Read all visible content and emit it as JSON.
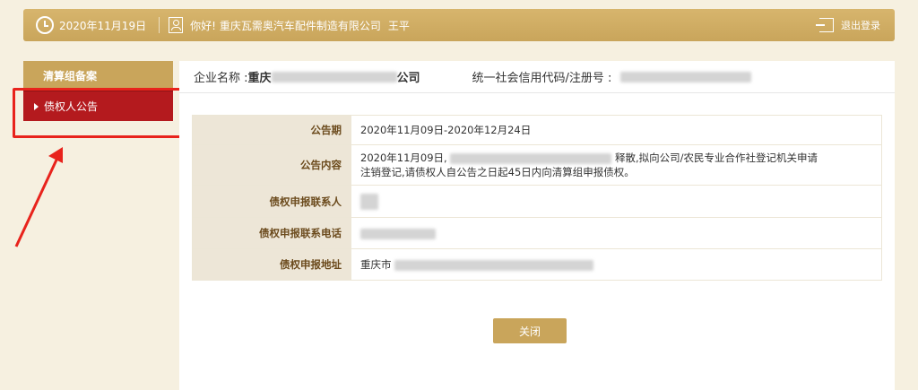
{
  "header": {
    "date": "2020年11月19日",
    "greeting": "你好!",
    "company": "重庆瓦需奥汽车配件制造有限公司",
    "username": "王平",
    "logout_label": "退出登录"
  },
  "sidebar": {
    "group_title": "清算组备案",
    "items": [
      {
        "label": "债权人公告",
        "active": true
      }
    ]
  },
  "main": {
    "company_name_label": "企业名称 :",
    "company_name_prefix": "重庆",
    "company_name_suffix": "公司",
    "credit_code_label": "统一社会信用代码/注册号 :",
    "rows": [
      {
        "key": "公告期",
        "value": "2020年11月09日-2020年12月24日"
      },
      {
        "key": "公告内容",
        "value_line1_prefix": "2020年11月09日,",
        "value_line1_suffix": "释散,拟向公司/农民专业合作社登记机关申请",
        "value_line2": "注销登记,请债权人自公告之日起45日内向清算组申报债权。"
      },
      {
        "key": "债权申报联系人",
        "value": ""
      },
      {
        "key": "债权申报联系电话",
        "value": ""
      },
      {
        "key": "债权申报地址",
        "value_prefix": "重庆市"
      }
    ],
    "close_label": "关闭"
  },
  "colors": {
    "gold": "#c9a55b",
    "active_red": "#b41a1e",
    "annotation_red": "#e8231c",
    "background": "#f6f0e0"
  }
}
